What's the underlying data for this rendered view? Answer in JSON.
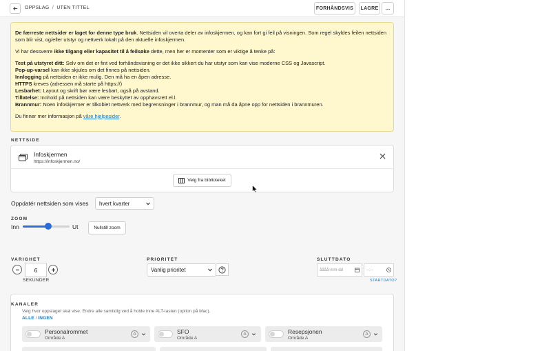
{
  "breadcrumb": {
    "root": "OPPSLAG",
    "separator": "/",
    "current": "UTEN TITTEL"
  },
  "toolbar": {
    "preview_label": "FORHÅNDSVIS",
    "save_label": "LAGRE",
    "more_label": "..."
  },
  "warning": {
    "intro_bold": "De færreste nettsider er laget for denne type bruk",
    "intro_rest": ". Nettsiden vil overta deler av infoskjermen, og kan fort gi feil på visningen. Som regel skyldes feilen nettsiden som blir vist, og/eller utstyr og nettverk lokalt på den aktuelle infoskjermen.",
    "second_pre": "Vi har dessverre ",
    "second_bold": "ikke tilgang eller kapasitet til å feilsøke",
    "second_post": " dette, men her er momenter som er viktige å tenke på:",
    "items": [
      {
        "term": "Test på utstyret ditt:",
        "text": " Selv om det er fint ved forhåndsvisning er det ikke sikkert du har utstyr som kan vise moderne CSS og Javascript."
      },
      {
        "term": "Pop-up-varsel",
        "text": " kan ikke skjules om det finnes på nettsiden."
      },
      {
        "term": "Innlogging",
        "text": " på nettsiden er ikke mulig. Den må ha en åpen adresse."
      },
      {
        "term": "HTTPS",
        "text": " kreves (adressen må starte på https://)"
      },
      {
        "term": "Lesbarhet:",
        "text": " Layout og skrift bør være lesbart, også på avstand."
      },
      {
        "term": "Tillatelse:",
        "text": " Innhold på nettsiden kan være beskyttet av opphavsrett el.l."
      },
      {
        "term": "Brannmur:",
        "text": " Noen infoskjermer er tilkoblet nettverk med begrensninger i brannmur, og man må da åpne opp for nettsiden i brannmuren."
      }
    ],
    "more_info_pre": "Du finner mer informasjon på ",
    "more_info_link": "våre hjelpesider",
    "more_info_post": "."
  },
  "website": {
    "section_label": "NETTSIDE",
    "name": "Infoskjermen",
    "url": "https://infoskjermen.no/",
    "library_button": "Velg fra biblioteket"
  },
  "update": {
    "label": "Oppdatér nettsiden som vises",
    "selected": "hvert kvarter"
  },
  "zoom": {
    "section_label": "ZOOM",
    "in_label": "Inn",
    "out_label": "Ut",
    "reset_label": "Nullstill zoom",
    "level": 0.55
  },
  "duration": {
    "section_label": "VARIGHET",
    "value": "6",
    "unit": "SEKUNDER"
  },
  "priority": {
    "section_label": "PRIORITET",
    "selected": "Vanlig prioritet"
  },
  "end_date": {
    "section_label": "SLUTTDATO",
    "date_placeholder": "åååå-mm-dd",
    "time_placeholder": "--:--",
    "start_date_link": "STARTDATO?"
  },
  "channels": {
    "section_label": "KANALER",
    "description": "Velg hvor oppslaget skal vise. Endre alle samtidig ved å holde inne ALT-tasten (option på Mac).",
    "all_link": "ALLE",
    "none_link": "INGEN",
    "items": [
      {
        "name": "Personalrommet",
        "area": "Område A",
        "badge": "A"
      },
      {
        "name": "SFO",
        "area": "Område A",
        "badge": "A"
      },
      {
        "name": "Resepsjonen",
        "area": "Område A",
        "badge": "A"
      }
    ]
  },
  "colors": {
    "accent": "#2b6fd6",
    "warning_bg": "#fff8cf",
    "link": "#1b76b8"
  }
}
